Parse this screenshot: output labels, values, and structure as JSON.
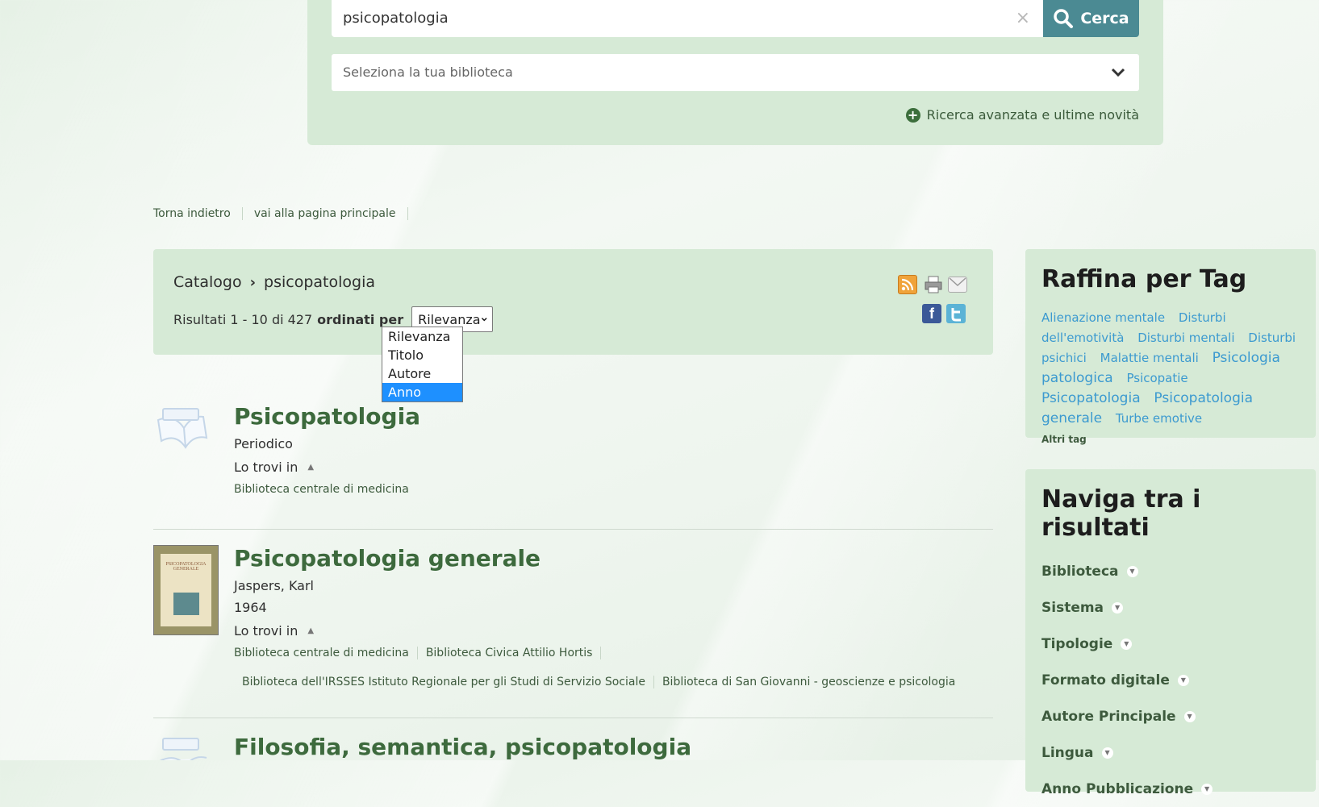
{
  "search": {
    "query": "psicopatologia",
    "clear_symbol": "×",
    "button_label": "Cerca",
    "library_placeholder": "Seleziona la tua biblioteca",
    "advanced_link": "Ricerca avanzata e ultime novità"
  },
  "top_nav": {
    "back": "Torna indietro",
    "home": "vai alla pagina principale"
  },
  "breadcrumb": {
    "root": "Catalogo",
    "current": "psicopatologia"
  },
  "results_info": {
    "range": "Risultati 1 - 10 di 427",
    "sorted_by": "ordinati per",
    "sort_selected": "Rilevanza",
    "sort_options": [
      "Rilevanza",
      "Titolo",
      "Autore",
      "Anno"
    ],
    "sort_highlighted": "Anno"
  },
  "results": [
    {
      "title": "Psicopatologia",
      "type": "Periodico",
      "lo_trovi": "Lo trovi in",
      "libraries": [
        "Biblioteca centrale di medicina"
      ]
    },
    {
      "title": "Psicopatologia generale",
      "author": "Jaspers, Karl",
      "year": "1964",
      "lo_trovi": "Lo trovi in",
      "cover_title": "PSICOPATOLOGIA GENERALE",
      "libraries": [
        "Biblioteca centrale di medicina",
        "Biblioteca Civica Attilio Hortis",
        "Biblioteca dell'IRSSES Istituto Regionale per gli Studi di Servizio Sociale",
        "Biblioteca di San Giovanni - geoscienze e psicologia"
      ]
    },
    {
      "title": "Filosofia, semantica, psicopatologia"
    }
  ],
  "sidebar": {
    "tags_title": "Raffina per Tag",
    "tags": [
      "Alienazione mentale",
      "Disturbi dell'emotività",
      "Disturbi mentali",
      "Disturbi psichici",
      "Malattie mentali",
      "Psicologia patologica",
      "Psicopatie",
      "Psicopatologia",
      "Psicopatologia generale",
      "Turbe emotive"
    ],
    "more_tags": "Altri tag",
    "nav_title": "Naviga tra i risultati",
    "facets": [
      "Biblioteca",
      "Sistema",
      "Tipologie",
      "Formato digitale",
      "Autore Principale",
      "Lingua",
      "Anno Pubblicazione"
    ]
  },
  "colors": {
    "panel": "#d6ead6",
    "accent": "#4b8a93",
    "title_green": "#3d6a3d",
    "tag_blue": "#3c9ad0"
  }
}
